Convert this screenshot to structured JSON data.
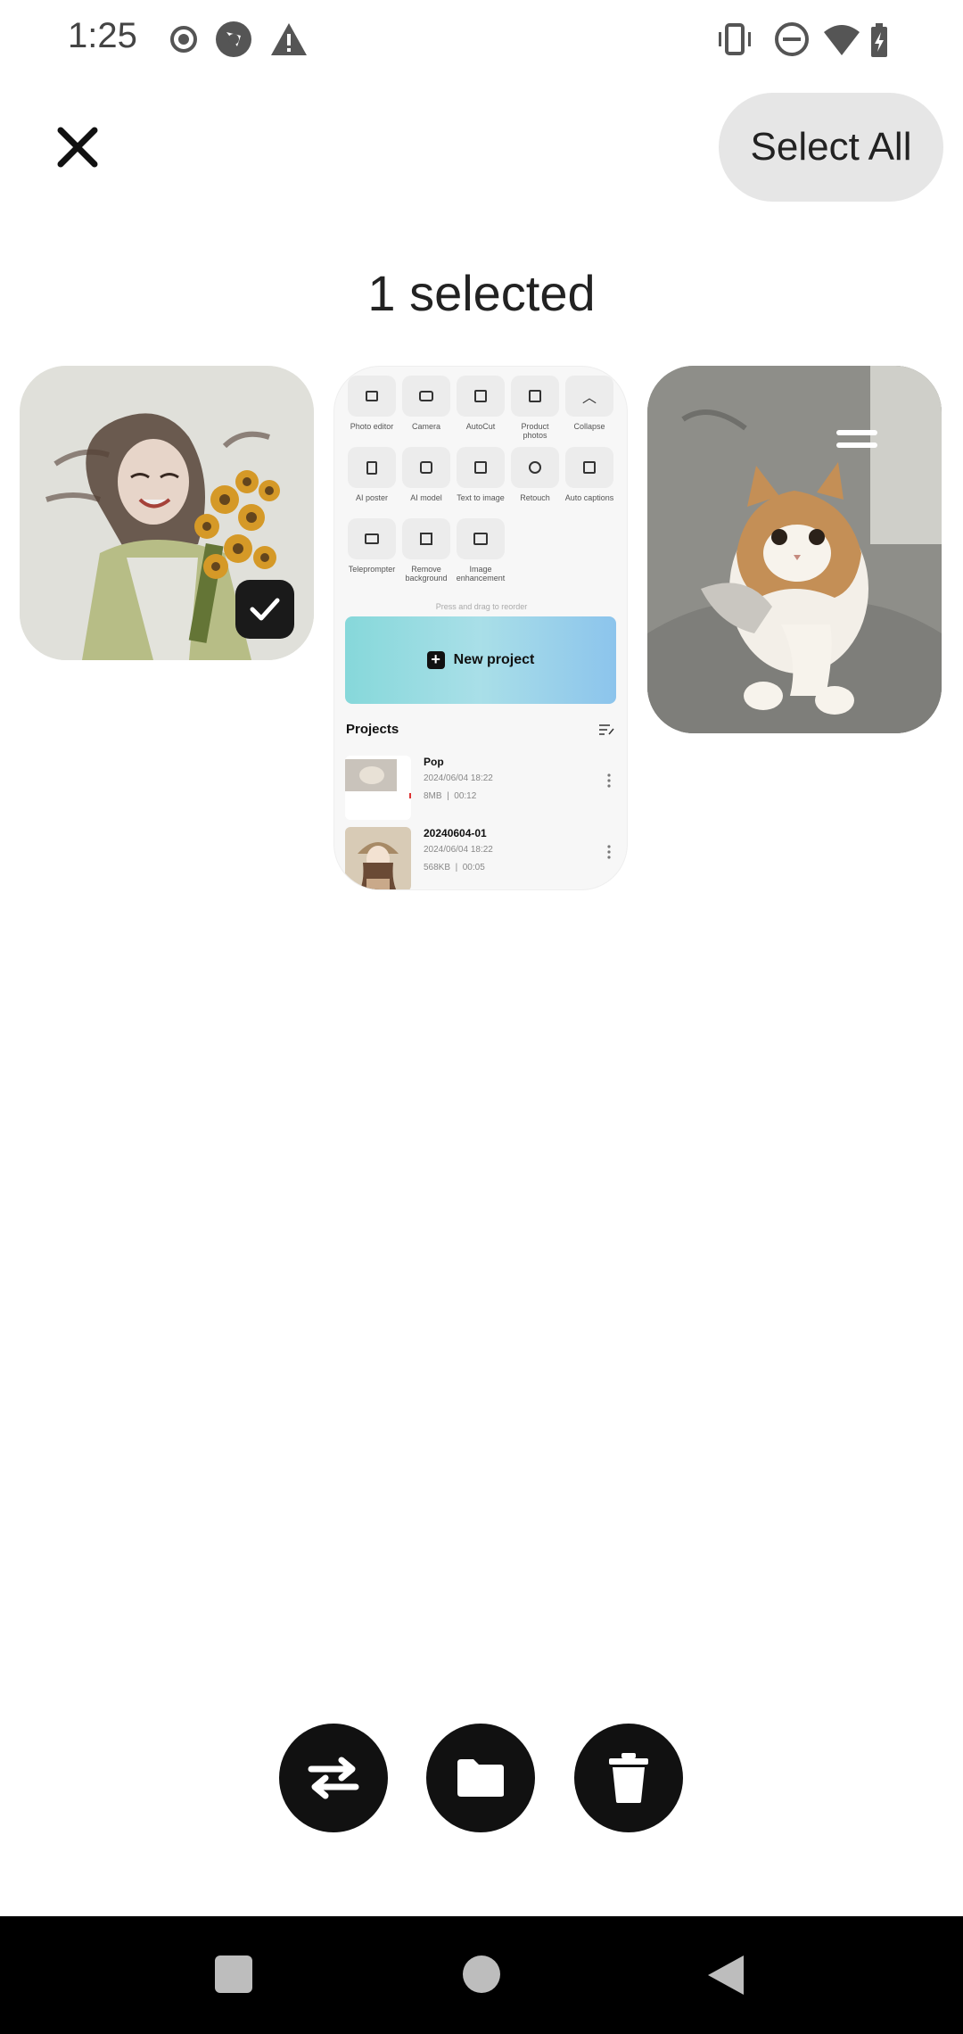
{
  "status_bar": {
    "time": "1:25",
    "left_icons": [
      "record-icon",
      "shutter-icon",
      "warning-icon"
    ],
    "right_icons": [
      "vibrate-icon",
      "dnd-icon",
      "wifi-icon",
      "battery-charging-icon"
    ]
  },
  "header": {
    "close_icon": "close-icon",
    "select_all_label": "Select All",
    "selected_text": "1 selected"
  },
  "cards": [
    {
      "subject": "girl-with-sunflowers-image",
      "selected": true
    },
    {
      "subject": "app-screenshot",
      "selected": false
    },
    {
      "subject": "cat-image",
      "selected": false
    }
  ],
  "app_screenshot": {
    "tools": [
      {
        "label": "Photo editor"
      },
      {
        "label": "Camera"
      },
      {
        "label": "AutoCut"
      },
      {
        "label": "Product photos"
      },
      {
        "label": "Collapse"
      },
      {
        "label": "AI poster"
      },
      {
        "label": "AI model"
      },
      {
        "label": "Text to image"
      },
      {
        "label": "Retouch"
      },
      {
        "label": "Auto captions"
      },
      {
        "label": "Teleprompter"
      },
      {
        "label": "Remove background"
      },
      {
        "label": "Image enhancement"
      }
    ],
    "hint": "Press and drag to reorder",
    "new_project_label": "New project",
    "projects_title": "Projects",
    "projects": [
      {
        "name": "Pop",
        "date": "2024/06/04 18:22",
        "size": "8MB",
        "duration": "00:12"
      },
      {
        "name": "20240604-01",
        "date": "2024/06/04 18:22",
        "size": "568KB",
        "duration": "00:05"
      }
    ]
  },
  "actions": [
    {
      "name": "swap-icon"
    },
    {
      "name": "folder-icon"
    },
    {
      "name": "trash-icon"
    }
  ],
  "nav_bar": {
    "buttons": [
      "recents-button",
      "home-button",
      "back-button"
    ]
  },
  "colors": {
    "select_all_bg": "#e6e6e6",
    "action_bg": "#111111",
    "nav_bg": "#000000"
  }
}
